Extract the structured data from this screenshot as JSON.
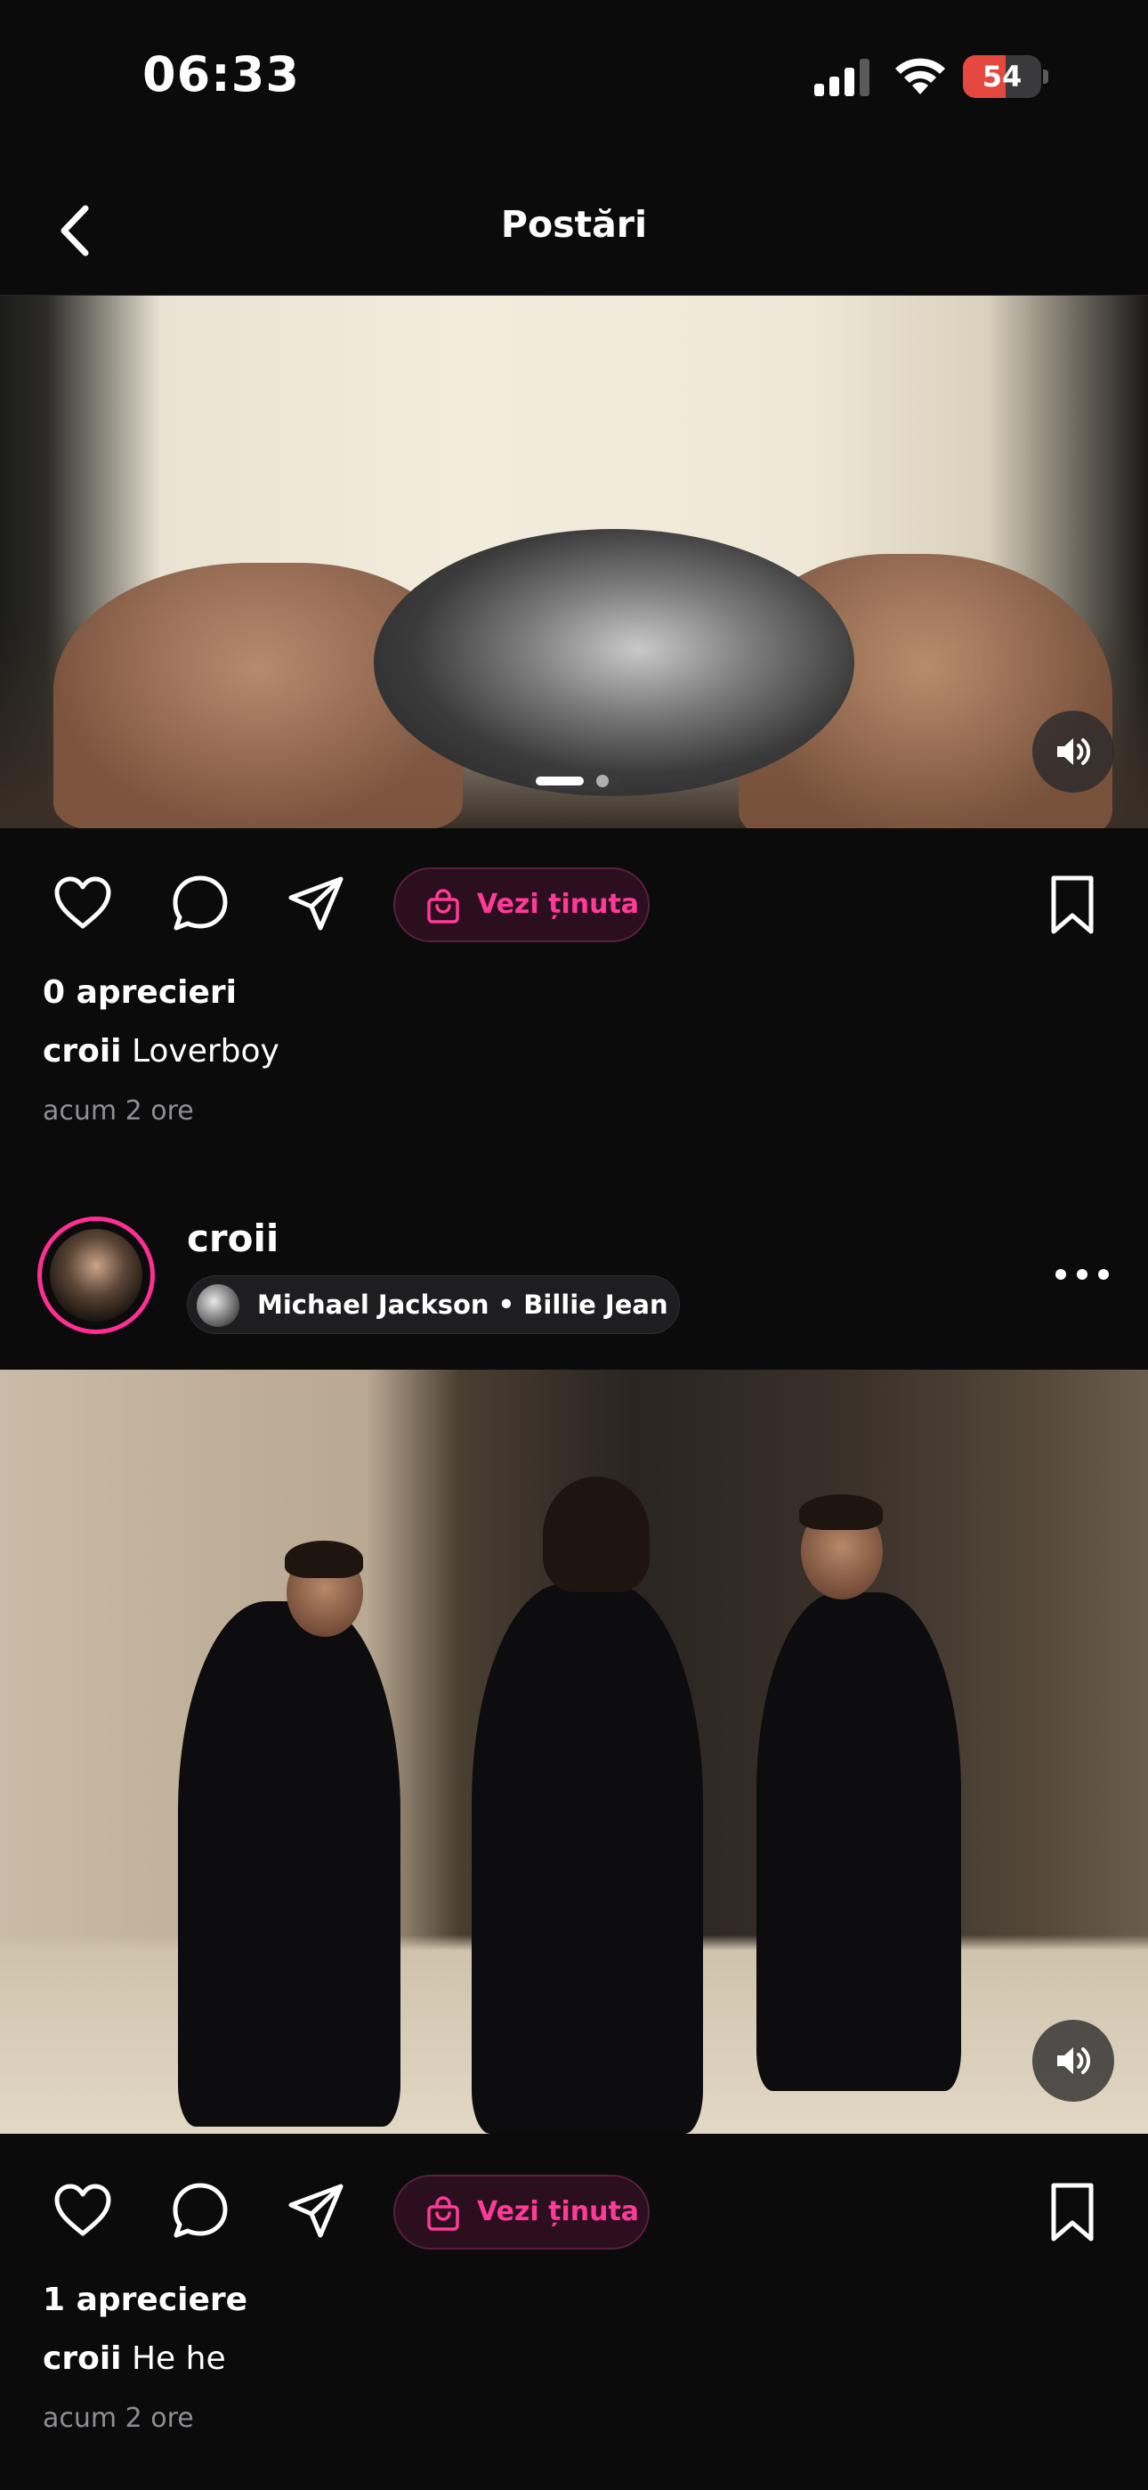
{
  "status_bar": {
    "time": "06:33",
    "battery_label": "54",
    "battery_level": 0.54,
    "battery_color": "#e5483f"
  },
  "header": {
    "title": "Postări",
    "back_icon": "chevron-left-icon"
  },
  "posts": [
    {
      "media_description_hidden": true,
      "carousel_pages": 2,
      "carousel_active": 1,
      "like_icon": "heart-icon",
      "comment_icon": "comment-icon",
      "share_icon": "send-icon",
      "outfit_button": "Vezi ținuta",
      "likes": "0 aprecieri",
      "caption_user": "croii",
      "caption_text": "Loverboy",
      "time_ago": "acum 2 ore"
    },
    {
      "username": "croii",
      "music": "Michael Jackson • Billie Jean",
      "outfit_button": "Vezi ținuta",
      "likes": "1 apreciere",
      "caption_user": "croii",
      "caption_text": "He he",
      "time_ago": "acum 2 ore"
    }
  ],
  "colors": {
    "accent": "#ff3a99",
    "background": "#0b0b0c",
    "muted_text": "#8e8e93"
  }
}
